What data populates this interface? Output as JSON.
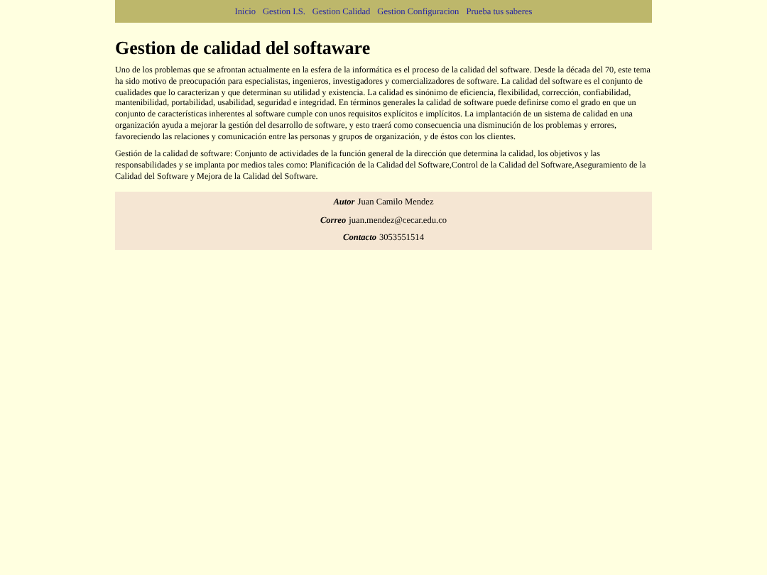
{
  "nav": [
    {
      "label": "Inicio"
    },
    {
      "label": "Gestion I.S."
    },
    {
      "label": "Gestion Calidad"
    },
    {
      "label": "Gestion Configuracion"
    },
    {
      "label": "Prueba tus saberes"
    }
  ],
  "title": "Gestion de calidad del softaware",
  "paragraphs": [
    "Uno de los problemas que se afrontan actualmente en la esfera de la informática es el proceso de la calidad del software. Desde la década del 70, este tema ha sido motivo de preocupación para especialistas, ingenieros, investigadores y comercializadores de software. La calidad del software es el conjunto de cualidades que lo caracterizan y que determinan su utilidad y existencia. La calidad es sinónimo de eficiencia, flexibilidad, corrección, confiabilidad, mantenibilidad, portabilidad, usabilidad, seguridad e integridad. En términos generales la calidad de software puede definirse como el grado en que un conjunto de características inherentes al software cumple con unos requisitos explícitos e implícitos. La implantación de un sistema de calidad en una organización ayuda a mejorar la gestión del desarrollo de software, y esto traerá como consecuencia una disminución de los problemas y errores, favoreciendo las relaciones y comunicación entre las personas y grupos de organización, y de éstos con los clientes.",
    "Gestión de la calidad de software: Conjunto de actividades de la función general de la dirección que determina la calidad, los objetivos y las responsabilidades y se implanta por medios tales como: Planificación de la Calidad del Software,Control de la Calidad del Software,Aseguramiento de la Calidad del Software y Mejora de la Calidad del Software."
  ],
  "footer": [
    {
      "label": "Autor",
      "value": "Juan Camilo Mendez"
    },
    {
      "label": "Correo",
      "value": "juan.mendez@cecar.edu.co"
    },
    {
      "label": "Contacto",
      "value": "3053551514"
    }
  ]
}
